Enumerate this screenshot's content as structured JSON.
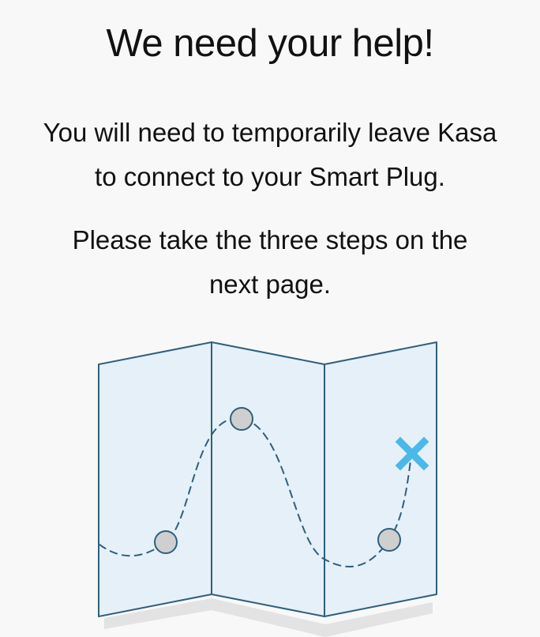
{
  "header": {
    "title": "We need your help!"
  },
  "message": {
    "line1a": "You will need to temporarily leave Kasa",
    "line1b": "to connect to your Smart Plug.",
    "line2a": "Please take the three steps on the",
    "line2b": "next page."
  },
  "illustration": {
    "icon": "folded-map-with-route-icon",
    "colors": {
      "paper": "#e6f0f8",
      "outline": "#2f5f7d",
      "route": "#2f5f7d",
      "waypoint": "#cfcfcf",
      "destination": "#4bb8ea",
      "shadow": "#e3e3e3"
    }
  }
}
